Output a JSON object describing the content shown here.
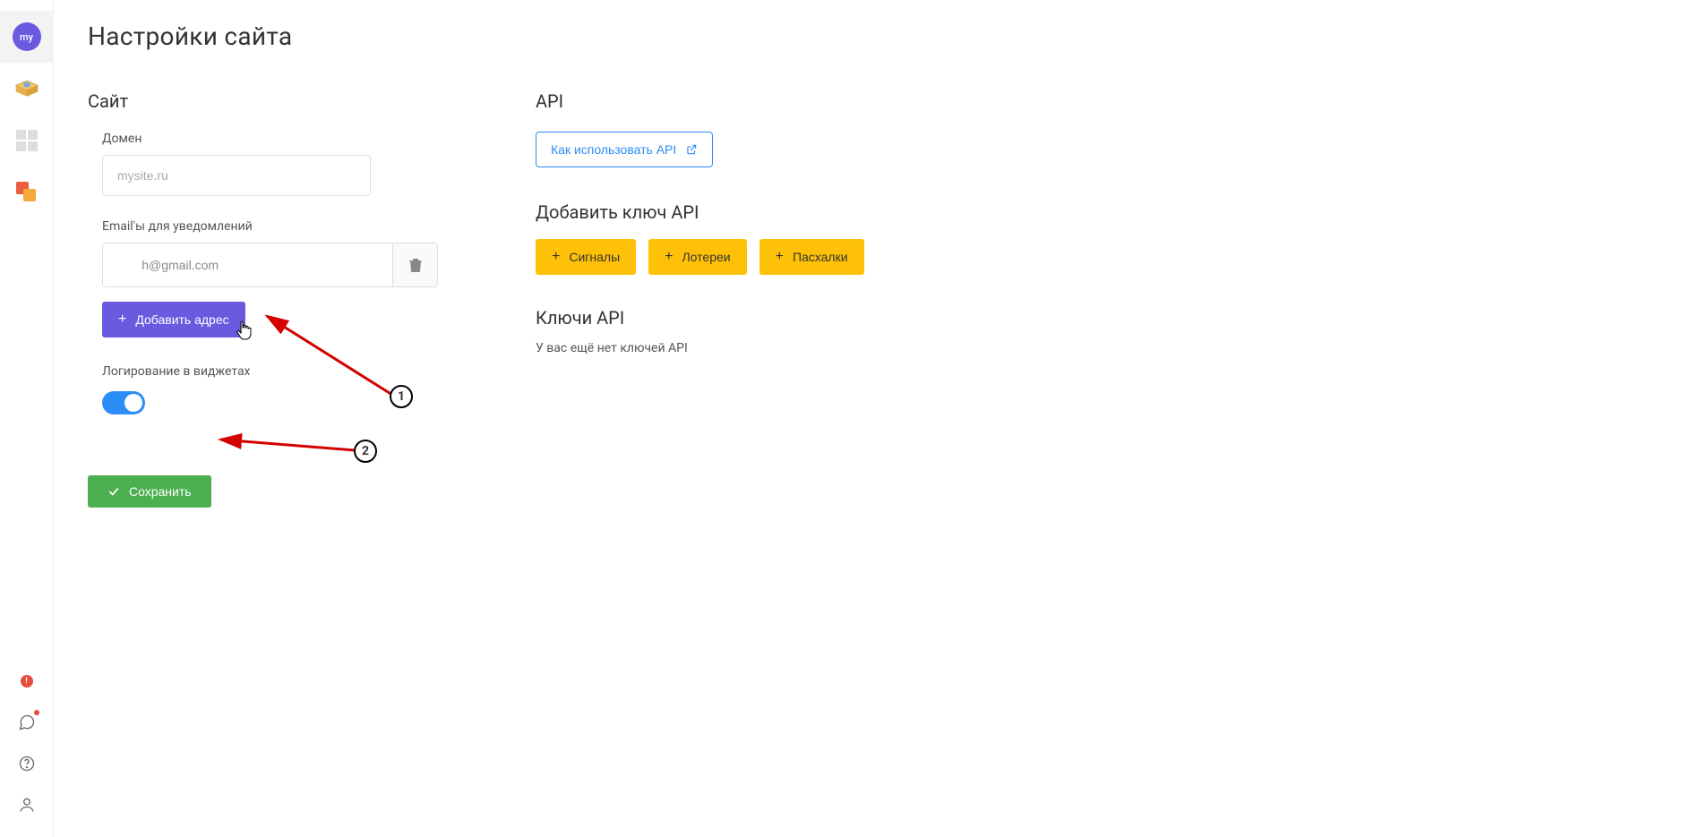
{
  "sidebar": {
    "avatar": "my"
  },
  "page": {
    "title": "Настройки сайта"
  },
  "site": {
    "section_title": "Сайт",
    "domain_label": "Домен",
    "domain_placeholder": "mysite.ru",
    "emails_label": "Email'ы для уведомлений",
    "email_value": "       h@gmail.com",
    "add_address_btn": "Добавить адрес",
    "logging_label": "Логирование в виджетах",
    "save_btn": "Сохранить"
  },
  "api": {
    "section_title": "API",
    "howto_btn": "Как использовать API",
    "add_key_title": "Добавить ключ API",
    "btn_signals": "Сигналы",
    "btn_lotteries": "Лотереи",
    "btn_easter": "Пасхалки",
    "keys_title": "Ключи API",
    "keys_empty": "У вас ещё нет ключей API"
  },
  "annotations": {
    "one": "1",
    "two": "2"
  }
}
